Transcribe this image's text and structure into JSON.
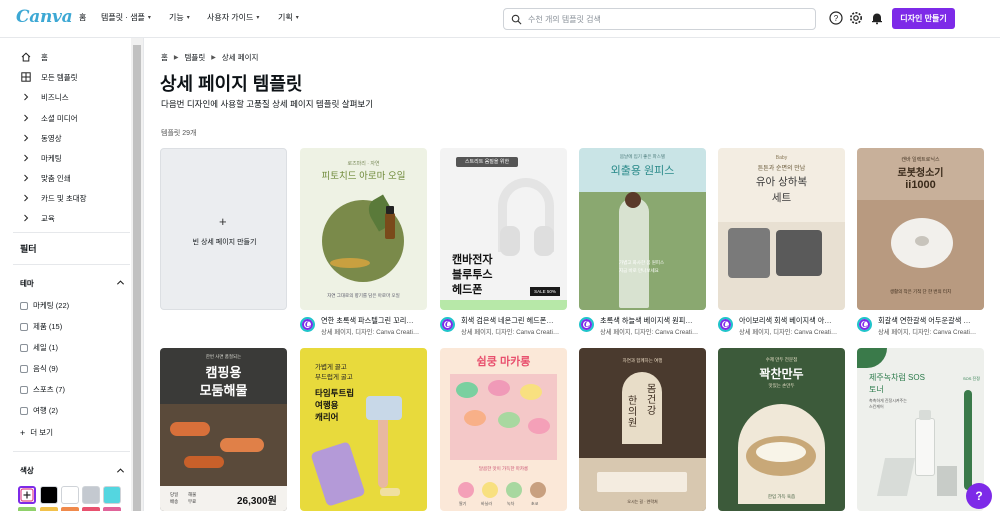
{
  "header": {
    "logo": "Canva",
    "nav": [
      {
        "label": "홈"
      },
      {
        "label": "템플릿 · 샘플"
      },
      {
        "label": "기능"
      },
      {
        "label": "사용자 가이드"
      },
      {
        "label": "기획"
      }
    ],
    "search_placeholder": "수천 개의 템플릿 검색",
    "create_button": "디자인 만들기"
  },
  "sidebar": {
    "items": [
      {
        "label": "홈",
        "icon": "home-icon"
      },
      {
        "label": "모든 템플릿",
        "icon": "grid-icon"
      },
      {
        "label": "비즈니스",
        "icon": "chevron-right-icon"
      },
      {
        "label": "소셜 미디어",
        "icon": "chevron-right-icon"
      },
      {
        "label": "동영상",
        "icon": "chevron-right-icon"
      },
      {
        "label": "마케팅",
        "icon": "chevron-right-icon"
      },
      {
        "label": "맞춤 인쇄",
        "icon": "chevron-right-icon"
      },
      {
        "label": "카드 및 초대장",
        "icon": "chevron-right-icon"
      },
      {
        "label": "교육",
        "icon": "chevron-right-icon"
      }
    ],
    "filter_heading": "필터",
    "theme_heading": "테마",
    "theme_options": [
      {
        "label": "마케팅 (22)"
      },
      {
        "label": "제품 (15)"
      },
      {
        "label": "세일 (1)"
      },
      {
        "label": "음식 (9)"
      },
      {
        "label": "스포츠 (7)"
      },
      {
        "label": "여행 (2)"
      }
    ],
    "more_label": "더 보기",
    "color_heading": "색상",
    "colors": [
      "#000000",
      "#ffffff",
      "#c4c9d0",
      "#54d6e0"
    ]
  },
  "main": {
    "breadcrumb": [
      "홈",
      "템플릿",
      "상세 페이지"
    ],
    "title": "상세 페이지 템플릿",
    "description": "다음번 디자인에 사용할 고품질 상세 페이지 템플릿 살펴보기",
    "count": "템플릿 29개",
    "blank_card_label": "빈 상세 페이지 만들기",
    "cards": [
      {
        "title": "연한 초록색 파스텔그린 꼬리…",
        "subtitle": "상세 페이지, 디자인: Canva Creati…",
        "lines": [
          "로즈마리 · 자연",
          "피토치드 아로마 오일",
          "자연 그대로의 향기를 담은 아로마 오일"
        ]
      },
      {
        "title": "회색 검은색 네온그린 헤드폰…",
        "subtitle": "상세 페이지, 디자인: Canva Creati…",
        "lines": [
          "스트리트 음질을 위한",
          "캔바전자",
          "블루투스",
          "헤드폰",
          "SALE 50%"
        ]
      },
      {
        "title": "초록색 하늘색 베이지색 원피…",
        "subtitle": "상세 페이지, 디자인: Canva Creati…",
        "lines": [
          "봄날에 입기 좋은 파스텔",
          "외출용 원피스",
          "가볍고 화사한 봄 원피스",
          "지금 바로 만나보세요"
        ]
      },
      {
        "title": "아이보리색 회색 베이지색 아…",
        "subtitle": "상세 페이지, 디자인: Canva Creati…",
        "lines": [
          "Baby",
          "튼튼과 순면의 만남",
          "유아 상하복",
          "세트"
        ]
      },
      {
        "title": "회갈색 연한갈색 어두운갈색 …",
        "subtitle": "상세 페이지, 디자인: Canva Creati…",
        "lines": [
          "캔바 일렉트로닉스",
          "로봇청소기",
          "ii1000",
          "생활의 작은 기적 단 한 번의 터치"
        ]
      },
      {
        "title": "",
        "subtitle": "",
        "lines": [
          "한번 사면 품절되는",
          "캠핑용",
          "모둠해물",
          "26,300원",
          "당일",
          "배송",
          "해물",
          "무료"
        ]
      },
      {
        "title": "",
        "subtitle": "",
        "lines": [
          "가볍게 끌고",
          "부드럽게 굴고",
          "타임투트립",
          "여행용",
          "캐리어"
        ]
      },
      {
        "title": "",
        "subtitle": "",
        "lines": [
          "쉼쿵 마카롱",
          "달콤한 맛이 가득한 마카롱",
          "딸기",
          "바닐라",
          "녹차",
          "초코"
        ]
      },
      {
        "title": "",
        "subtitle": "",
        "lines": [
          "자연과 함께하는 여행",
          "몸건강",
          "한의원",
          "오시는 길 · 연락처"
        ]
      },
      {
        "title": "",
        "subtitle": "",
        "lines": [
          "수제 만두 전문점",
          "꽉찬만두",
          "맛있는 손만두",
          "한입 가득 육즙"
        ]
      },
      {
        "title": "",
        "subtitle": "",
        "lines": [
          "제주녹차럼 SOS",
          "토너",
          "촉촉하게 진정시켜주는",
          "스킨케어",
          "SOS 진정"
        ]
      }
    ]
  },
  "colors": {
    "accent": "#7d2ae8",
    "brand": "#3da8d4"
  }
}
